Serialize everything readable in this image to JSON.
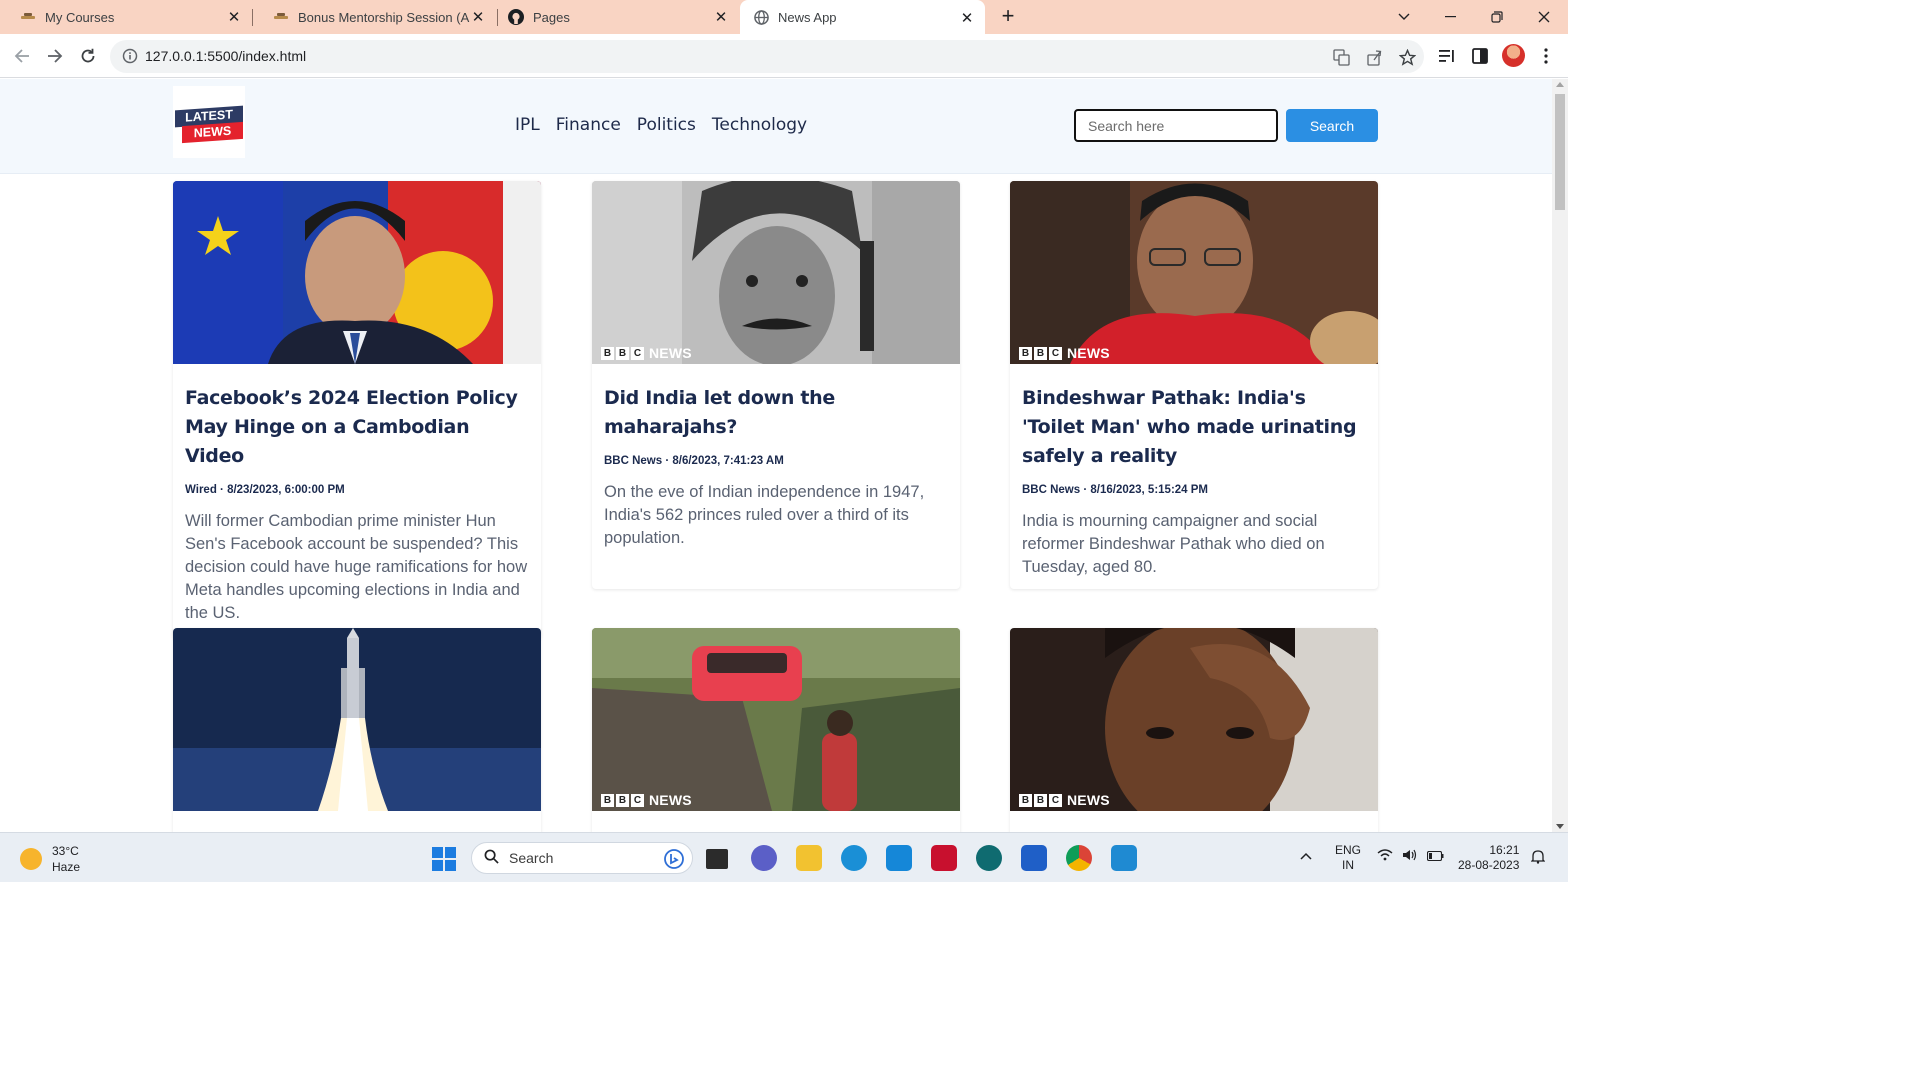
{
  "browser": {
    "tabs": [
      {
        "title": "My Courses",
        "active": false
      },
      {
        "title": "Bonus Mentorship Session (Ama…",
        "active": false
      },
      {
        "title": "Pages",
        "active": false
      },
      {
        "title": "News App",
        "active": true
      }
    ],
    "url": "127.0.0.1:5500/index.html"
  },
  "site": {
    "logo": {
      "line1": "LATEST",
      "line2": "NEWS"
    },
    "nav_links": [
      "IPL",
      "Finance",
      "Politics",
      "Technology"
    ],
    "search": {
      "placeholder": "Search here",
      "value": "",
      "button_label": "Search"
    }
  },
  "bbc_badge": {
    "letters": [
      "B",
      "B",
      "C"
    ],
    "word": "NEWS"
  },
  "articles": [
    {
      "title": "Facebook’s 2024 Election Policy May Hinge on a Cambodian Video",
      "meta": "Wired · 8/23/2023, 6:00:00 PM",
      "description": "Will former Cambodian prime minister Hun Sen's Facebook account be suspended? This decision could have huge ramifications for how Meta handles upcoming elections in India and the US.",
      "image": "cambodia-flags-portrait",
      "bbc_badge": false
    },
    {
      "title": "Did India let down the maharajahs?",
      "meta": "BBC News · 8/6/2023, 7:41:23 AM",
      "description": "On the eve of Indian independence in 1947, India's 562 princes ruled over a third of its population.",
      "image": "maharaja-portrait",
      "bbc_badge": true
    },
    {
      "title": "Bindeshwar Pathak: India's 'Toilet Man' who made urinating safely a reality",
      "meta": "BBC News · 8/16/2023, 5:15:24 PM",
      "description": "India is mourning campaigner and social reformer Bindeshwar Pathak who died on Tuesday, aged 80.",
      "image": "man-red-shirt-portrait",
      "bbc_badge": true
    },
    {
      "title": "",
      "meta": "",
      "description": "",
      "image": "rocket-launch",
      "bbc_badge": false
    },
    {
      "title": "",
      "meta": "",
      "description": "",
      "image": "car-cliff",
      "bbc_badge": true
    },
    {
      "title": "",
      "meta": "",
      "description": "",
      "image": "chess-player",
      "bbc_badge": true
    }
  ],
  "taskbar": {
    "weather": {
      "temp": "33°C",
      "condition": "Haze"
    },
    "search_label": "Search",
    "language": {
      "line1": "ENG",
      "line2": "IN"
    },
    "clock": {
      "time": "16:21",
      "date": "28-08-2023"
    },
    "apps": [
      "task-view-icon",
      "chat-icon",
      "file-explorer-icon",
      "edge-icon",
      "l-app-icon",
      "mcafee-icon",
      "circle-app-icon",
      "store-icon",
      "chrome-icon",
      "vscode-icon"
    ]
  },
  "colors": {
    "tab_strip": "#f9d4c3",
    "site_nav": "#f3f8fd",
    "heading": "#1b2a4e",
    "search_button": "#2b8fe3",
    "logo_blue": "#2d3b64",
    "logo_red": "#e4222d"
  }
}
